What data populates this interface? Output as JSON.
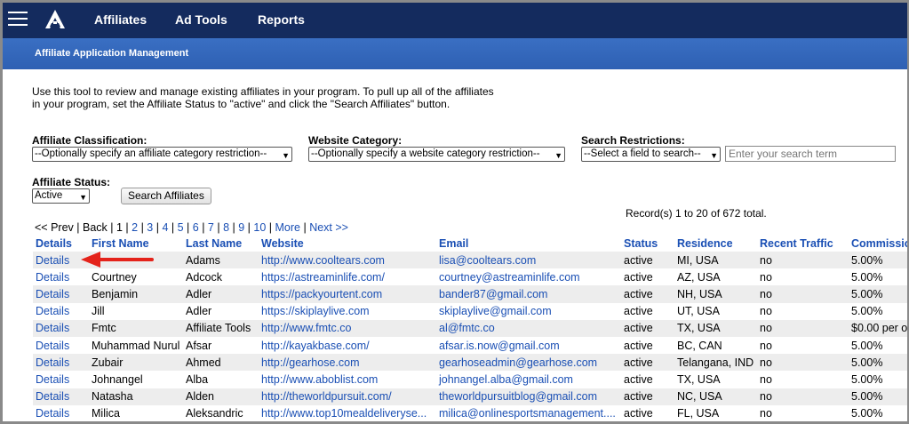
{
  "nav": {
    "items": [
      "Affiliates",
      "Ad Tools",
      "Reports"
    ]
  },
  "subbar": {
    "title": "Affiliate Application Management"
  },
  "intro": "Use this tool to review and manage existing affiliates in your program. To pull up all of the affiliates in your program, set the Affiliate Status to \"active\" and click the \"Search Affiliates\" button.",
  "filters": {
    "classification_label": "Affiliate Classification:",
    "classification_value": "--Optionally specify an affiliate category restriction--",
    "website_category_label": "Website Category:",
    "website_category_value": "--Optionally specify a website category restriction--",
    "search_restrictions_label": "Search Restrictions:",
    "search_field_value": "--Select a field to search--",
    "search_term_placeholder": "Enter your search term",
    "status_label": "Affiliate Status:",
    "status_value": "Active",
    "search_button": "Search Affiliates"
  },
  "pager": {
    "prev": "<< Prev",
    "back": "Back",
    "current": "1",
    "pages": [
      "2",
      "3",
      "4",
      "5",
      "6",
      "7",
      "8",
      "9",
      "10"
    ],
    "more": "More",
    "next": "Next >>"
  },
  "records": "Record(s) 1 to 20 of 672 total.",
  "table": {
    "headers": [
      "Details",
      "First Name",
      "Last Name",
      "Website",
      "Email",
      "Status",
      "Residence",
      "Recent Traffic",
      "Commission"
    ],
    "rows": [
      [
        "Details",
        "",
        "Adams",
        "http://www.cooltears.com",
        "lisa@cooltears.com",
        "active",
        "MI, USA",
        "no",
        "5.00%"
      ],
      [
        "Details",
        "Courtney",
        "Adcock",
        "https://astreaminlife.com/",
        "courtney@astreaminlife.com",
        "active",
        "AZ, USA",
        "no",
        "5.00%"
      ],
      [
        "Details",
        "Benjamin",
        "Adler",
        "https://packyourtent.com",
        "bander87@gmail.com",
        "active",
        "NH, USA",
        "no",
        "5.00%"
      ],
      [
        "Details",
        "Jill",
        "Adler",
        "https://skiplaylive.com",
        "skiplaylive@gmail.com",
        "active",
        "UT, USA",
        "no",
        "5.00%"
      ],
      [
        "Details",
        "Fmtc",
        "Affiliate Tools",
        "http://www.fmtc.co",
        "al@fmtc.co",
        "active",
        "TX, USA",
        "no",
        "$0.00 per o"
      ],
      [
        "Details",
        "Muhammad Nurul",
        "Afsar",
        "http://kayakbase.com/",
        "afsar.is.now@gmail.com",
        "active",
        "BC, CAN",
        "no",
        "5.00%"
      ],
      [
        "Details",
        "Zubair",
        "Ahmed",
        "http://gearhose.com",
        "gearhoseadmin@gearhose.com",
        "active",
        "Telangana, IND",
        "no",
        "5.00%"
      ],
      [
        "Details",
        "Johnangel",
        "Alba",
        "http://www.aboblist.com",
        "johnangel.alba@gmail.com",
        "active",
        "TX, USA",
        "no",
        "5.00%"
      ],
      [
        "Details",
        "Natasha",
        "Alden",
        "http://theworldpursuit.com/",
        "theworldpursuitblog@gmail.com",
        "active",
        "NC, USA",
        "no",
        "5.00%"
      ],
      [
        "Details",
        "Milica",
        "Aleksandric",
        "http://www.top10mealdeliveryse...",
        "milica@onlinesportsmanagement....",
        "active",
        "FL, USA",
        "no",
        "5.00%"
      ]
    ]
  },
  "colors": {
    "nav_bg": "#142b5e",
    "subbar_bg": "#2e60b3",
    "link": "#1a4fb4",
    "annotation_arrow": "#e4231b"
  },
  "icons": {
    "menu": "hamburger-icon",
    "logo": "logo-icon",
    "annotation": "red-arrow-annotation"
  }
}
